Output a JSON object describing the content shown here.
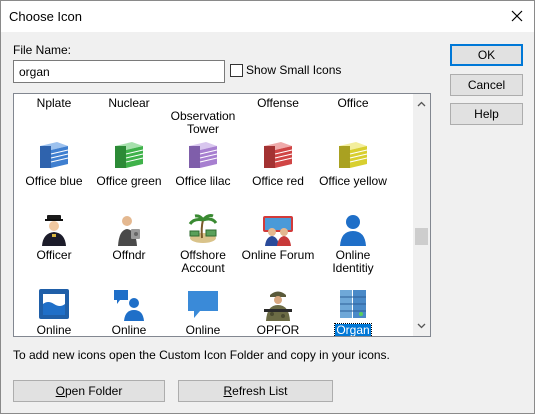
{
  "window": {
    "title": "Choose Icon"
  },
  "form": {
    "file_name_label": "File Name:",
    "file_name_value": "organ",
    "show_small_icons_label": "Show Small Icons",
    "show_small_icons_checked": false
  },
  "buttons": {
    "ok": "OK",
    "cancel": "Cancel",
    "help": "Help",
    "open_folder_prefix": "O",
    "open_folder_rest": "pen Folder",
    "refresh_prefix": "R",
    "refresh_rest": "efresh List"
  },
  "icon_grid": {
    "top_row_labels": [
      "Nplate",
      "Nuclear",
      "Observation\nTower",
      "Offense",
      "Office"
    ],
    "rows": [
      [
        {
          "label": "Office blue",
          "icon": "server-rack-blue-icon",
          "color": "#3f7fd0"
        },
        {
          "label": "Office green",
          "icon": "server-rack-green-icon",
          "color": "#3fb24a"
        },
        {
          "label": "Office lilac",
          "icon": "server-rack-lilac-icon",
          "color": "#a77fd0"
        },
        {
          "label": "Office red",
          "icon": "server-rack-red-icon",
          "color": "#d04545"
        },
        {
          "label": "Office yellow",
          "icon": "server-rack-yellow-icon",
          "color": "#d8cf2f"
        }
      ],
      [
        {
          "label": "Officer",
          "icon": "police-officer-icon"
        },
        {
          "label": "Offndr",
          "icon": "offender-icon"
        },
        {
          "label": "Offshore Account",
          "icon": "offshore-account-icon"
        },
        {
          "label": "Online Forum",
          "icon": "online-forum-icon"
        },
        {
          "label": "Online Identitiy",
          "icon": "online-identity-icon"
        }
      ],
      [
        {
          "label": "Online",
          "icon": "online-window-icon"
        },
        {
          "label": "Online",
          "icon": "online-user-chat-icon"
        },
        {
          "label": "Online Posting",
          "icon": "speech-bubble-icon"
        },
        {
          "label": "OPFOR",
          "icon": "soldier-icon"
        },
        {
          "label": "Organ",
          "icon": "organ-server-icon",
          "selected": true
        }
      ]
    ]
  },
  "hint_text": "To add new icons open the Custom Icon Folder and copy in your icons."
}
